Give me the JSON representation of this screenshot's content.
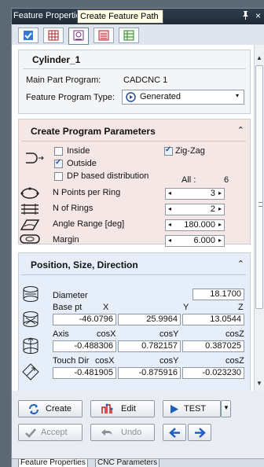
{
  "window": {
    "title": "Feature Properties",
    "pin_glyph": " p",
    "close_glyph": "×"
  },
  "tooltip": "Create Feature Path",
  "toolbar": [
    {
      "name": "properties-tab",
      "icon": "checkbox-icon",
      "active": false
    },
    {
      "name": "program-tab",
      "icon": "grid-icon",
      "active": false
    },
    {
      "name": "feature-path-tab",
      "icon": "path-icon",
      "active": true
    },
    {
      "name": "operations-tab",
      "icon": "list-icon",
      "active": false
    },
    {
      "name": "table-tab",
      "icon": "table-icon",
      "active": false
    }
  ],
  "feature": {
    "name": "Cylinder_1"
  },
  "info": {
    "main_part_label": "Main Part Program:",
    "main_part_value": "CADCNC 1",
    "feature_type_label": "Feature Program Type:",
    "feature_type_value": "Generated"
  },
  "create_params": {
    "title": "Create Program Parameters",
    "inside": {
      "label": "Inside",
      "checked": false
    },
    "outside": {
      "label": "Outside",
      "checked": true
    },
    "zigzag": {
      "label": "Zig-Zag",
      "checked": true
    },
    "dp_based": {
      "label": "DP based distribution",
      "checked": false
    },
    "all_label": "All :",
    "all_value": "6",
    "rows": [
      {
        "label": "N Points per Ring",
        "value": "3"
      },
      {
        "label": "N of Rings",
        "value": "2"
      },
      {
        "label": "Angle Range [deg]",
        "value": "180.000"
      },
      {
        "label": "Margin",
        "value": "6.000"
      }
    ]
  },
  "position": {
    "title": "Position, Size, Direction",
    "diameter_label": "Diameter",
    "diameter_value": "18.1700",
    "base": {
      "label": "Base pt",
      "hx": "X",
      "hy": "Y",
      "hz": "Z",
      "x": "-46.0796",
      "y": "25.9964",
      "z": "13.0544"
    },
    "axis": {
      "label": "Axis",
      "hx": "cosX",
      "hy": "cosY",
      "hz": "cosZ",
      "x": "-0.488306",
      "y": "0.782157",
      "z": "0.387025"
    },
    "touch": {
      "label": "Touch Dir",
      "hx": "cosX",
      "hy": "cosY",
      "hz": "cosZ",
      "x": "-0.481905",
      "y": "-0.875916",
      "z": "-0.023230"
    }
  },
  "buttons": {
    "create": "Create",
    "edit": "Edit",
    "test": "TEST",
    "accept": "Accept",
    "undo": "Undo"
  },
  "bottom_tabs": [
    "Feature Properties",
    "CNC Parameters"
  ],
  "colors": {
    "create_bg": "#f6e7e7",
    "position_bg": "#e5eef9",
    "accent": "#1f5fbf"
  }
}
